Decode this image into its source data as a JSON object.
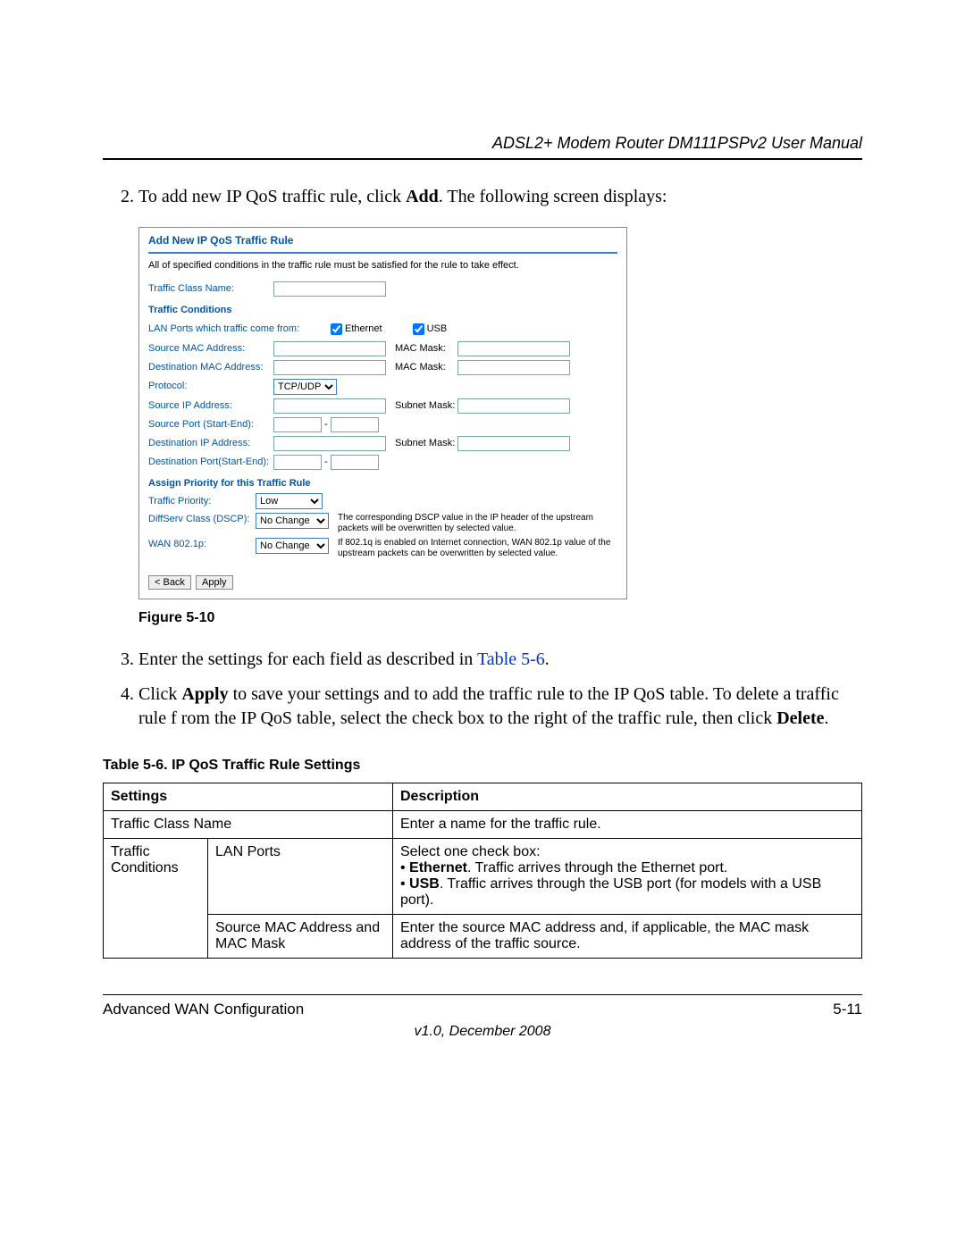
{
  "header": {
    "title": "ADSL2+ Modem Router DM111PSPv2 User Manual"
  },
  "steps": {
    "s2_pre": "To add new IP QoS traffic rule, click ",
    "s2_bold": "Add",
    "s2_post": ". The following screen displays:",
    "s3_pre": "Enter the settings for each field as described in ",
    "s3_link": "Table 5-6",
    "s3_post": ".",
    "s4_pre": "Click ",
    "s4_bold1": "Apply",
    "s4_mid": " to save your settings and to add the traffic rule to the IP QoS table. To delete a traffic rule f rom the IP QoS table, select the check box to the right of the traffic rule, then click ",
    "s4_bold2": "Delete",
    "s4_post": "."
  },
  "figure_caption": "Figure 5-10",
  "table_caption": "Table 5-6.   IP QoS Traffic Rule Settings",
  "table": {
    "head": {
      "c1": "Settings",
      "c2": "Description"
    },
    "rows": [
      {
        "a": "Traffic Class Name",
        "b": "",
        "d": "Enter a name for the traffic rule."
      },
      {
        "a": "Traffic Conditions",
        "b": "LAN Ports",
        "d_pre": "Select one check box:",
        "d_b1_bold": "Ethernet",
        "d_b1_rest": ". Traffic arrives through the Ethernet port.",
        "d_b2_bold": "USB",
        "d_b2_rest": ". Traffic arrives through the USB port (for models with a USB port)."
      },
      {
        "a": "",
        "b": "Source MAC Address and MAC Mask",
        "d": "Enter the source MAC address and, if applicable, the MAC mask address of the traffic source."
      }
    ]
  },
  "footer": {
    "left": "Advanced WAN Configuration",
    "right": "5-11",
    "version": "v1.0, December 2008"
  },
  "shot": {
    "title": "Add New IP QoS Traffic Rule",
    "intro": "All of specified conditions in the traffic rule must be satisfied for the rule to take effect.",
    "traffic_class_name_label": "Traffic Class Name:",
    "section_conditions": "Traffic Conditions",
    "lan_ports_label": "LAN Ports which traffic come from:",
    "ethernet": "Ethernet",
    "usb": "USB",
    "src_mac_label": "Source MAC Address:",
    "mac_mask_label": "MAC Mask:",
    "dst_mac_label": "Destination MAC Address:",
    "protocol_label": "Protocol:",
    "protocol_value": "TCP/UDP",
    "src_ip_label": "Source IP Address:",
    "subnet_mask_label": "Subnet Mask:",
    "src_port_label": "Source Port (Start-End):",
    "dst_ip_label": "Destination IP Address:",
    "dst_port_label": "Destination Port(Start-End):",
    "section_priority": "Assign Priority for this Traffic Rule",
    "priority_label": "Traffic Priority:",
    "priority_value": "Low",
    "dscp_label": "DiffServ Class (DSCP):",
    "dscp_value": "No Change",
    "dscp_hint": "The corresponding DSCP value in the IP header of the upstream packets will be overwritten by selected value.",
    "wan_label": "WAN 802.1p:",
    "wan_value": "No Change",
    "wan_hint": "If 802.1q is enabled on Internet connection, WAN 802.1p value of the upstream packets can be overwritten by selected value.",
    "back_btn": "< Back",
    "apply_btn": "Apply"
  }
}
